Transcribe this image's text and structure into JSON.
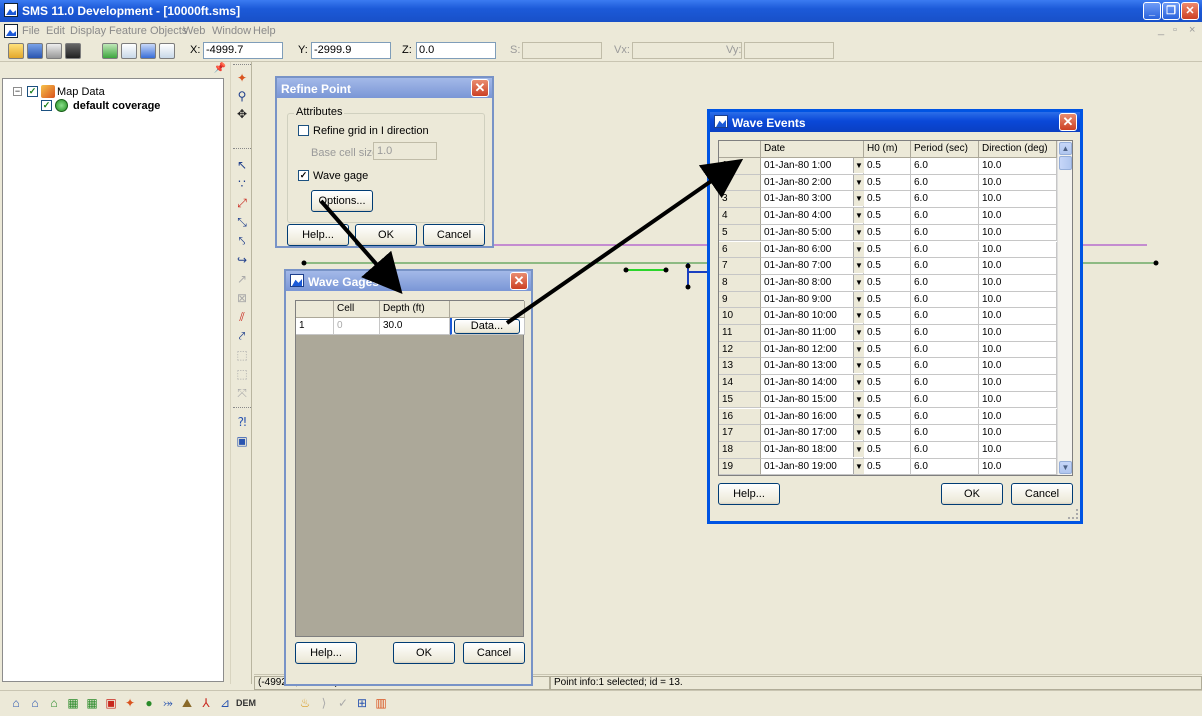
{
  "window": {
    "title": "SMS 11.0 Development - [10000ft.sms]",
    "min_glyph": "_",
    "restore_glyph": "❐",
    "close_glyph": "✕"
  },
  "menu": {
    "items": [
      "File",
      "Edit",
      "Display",
      "Feature Objects",
      "Web",
      "Window",
      "Help"
    ],
    "mdi_min": "_",
    "mdi_restore": "▫",
    "mdi_close": "×"
  },
  "toolbar": {
    "x_label": "X:",
    "x_value": "-4999.7",
    "y_label": "Y:",
    "y_value": "-2999.9",
    "z_label": "Z:",
    "z_value": "0.0",
    "s_label": "S:",
    "s_value": "",
    "vx_label": "Vx:",
    "vx_value": "",
    "vy_label": "Vy:",
    "vy_value": ""
  },
  "tree": {
    "root_label": "Map Data",
    "child_label": "default coverage",
    "expander": "−",
    "check": "✓"
  },
  "refine_point": {
    "title": "Refine Point",
    "group_label": "Attributes",
    "refine_label": "Refine grid in I direction",
    "refine_checked": false,
    "base_cell_label": "Base cell size:",
    "base_cell_value": "1.0",
    "wave_gage_label": "Wave gage",
    "wave_gage_checked": true,
    "options_label": "Options...",
    "help_label": "Help...",
    "ok_label": "OK",
    "cancel_label": "Cancel"
  },
  "wave_gages": {
    "title": "Wave Gages",
    "headers": [
      "Cell",
      "Depth (ft)"
    ],
    "row_num": "1",
    "cell_value": "0",
    "depth_value": "30.0",
    "data_button": "Data...",
    "help_label": "Help...",
    "ok_label": "OK",
    "cancel_label": "Cancel"
  },
  "wave_events": {
    "title": "Wave Events",
    "headers": [
      "Date",
      "H0 (m)",
      "Period (sec)",
      "Direction (deg)"
    ],
    "rows": [
      {
        "n": "1",
        "date": "01-Jan-80 1:00",
        "h0": "0.5",
        "period": "6.0",
        "dir": "10.0"
      },
      {
        "n": "2",
        "date": "01-Jan-80 2:00",
        "h0": "0.5",
        "period": "6.0",
        "dir": "10.0"
      },
      {
        "n": "3",
        "date": "01-Jan-80 3:00",
        "h0": "0.5",
        "period": "6.0",
        "dir": "10.0"
      },
      {
        "n": "4",
        "date": "01-Jan-80 4:00",
        "h0": "0.5",
        "period": "6.0",
        "dir": "10.0"
      },
      {
        "n": "5",
        "date": "01-Jan-80 5:00",
        "h0": "0.5",
        "period": "6.0",
        "dir": "10.0"
      },
      {
        "n": "6",
        "date": "01-Jan-80 6:00",
        "h0": "0.5",
        "period": "6.0",
        "dir": "10.0"
      },
      {
        "n": "7",
        "date": "01-Jan-80 7:00",
        "h0": "0.5",
        "period": "6.0",
        "dir": "10.0"
      },
      {
        "n": "8",
        "date": "01-Jan-80 8:00",
        "h0": "0.5",
        "period": "6.0",
        "dir": "10.0"
      },
      {
        "n": "9",
        "date": "01-Jan-80 9:00",
        "h0": "0.5",
        "period": "6.0",
        "dir": "10.0"
      },
      {
        "n": "10",
        "date": "01-Jan-80 10:00",
        "h0": "0.5",
        "period": "6.0",
        "dir": "10.0"
      },
      {
        "n": "11",
        "date": "01-Jan-80 11:00",
        "h0": "0.5",
        "period": "6.0",
        "dir": "10.0"
      },
      {
        "n": "12",
        "date": "01-Jan-80 12:00",
        "h0": "0.5",
        "period": "6.0",
        "dir": "10.0"
      },
      {
        "n": "13",
        "date": "01-Jan-80 13:00",
        "h0": "0.5",
        "period": "6.0",
        "dir": "10.0"
      },
      {
        "n": "14",
        "date": "01-Jan-80 14:00",
        "h0": "0.5",
        "period": "6.0",
        "dir": "10.0"
      },
      {
        "n": "15",
        "date": "01-Jan-80 15:00",
        "h0": "0.5",
        "period": "6.0",
        "dir": "10.0"
      },
      {
        "n": "16",
        "date": "01-Jan-80 16:00",
        "h0": "0.5",
        "period": "6.0",
        "dir": "10.0"
      },
      {
        "n": "17",
        "date": "01-Jan-80 17:00",
        "h0": "0.5",
        "period": "6.0",
        "dir": "10.0"
      },
      {
        "n": "18",
        "date": "01-Jan-80 18:00",
        "h0": "0.5",
        "period": "6.0",
        "dir": "10.0"
      },
      {
        "n": "19",
        "date": "01-Jan-80 19:00",
        "h0": "0.5",
        "period": "6.0",
        "dir": "10.0"
      }
    ],
    "dropdown_glyph": "▼",
    "scroll_up_glyph": "▲",
    "scroll_down_glyph": "▼",
    "help_label": "Help...",
    "ok_label": "OK",
    "cancel_label": "Cancel"
  },
  "status": {
    "coords": "(-4992.7, -3000.0)",
    "point_info": "Point info:1 selected; id = 13."
  },
  "bottom_toolbar": {
    "dem_label": "DEM"
  },
  "colors": {
    "title_blue": "#0a48d8",
    "canvas_bg": "#ece9d8",
    "line_purple": "#9b30c8",
    "line_green": "#2e8b2e",
    "line_bright_green": "#2bd52b",
    "line_blue": "#1a3fc0"
  }
}
